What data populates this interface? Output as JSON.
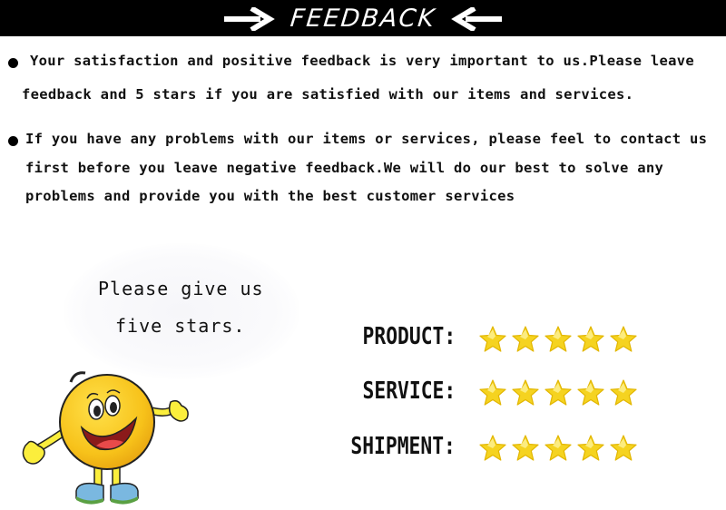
{
  "banner": {
    "title": "FEEDBACK",
    "left_icon": "arrow-right-icon",
    "right_icon": "arrow-left-icon",
    "background": "#000000",
    "text_color": "#ffffff"
  },
  "paragraphs": [
    {
      "bullet": "bullet-icon",
      "lines": [
        "Your satisfaction and positive feedback is very important to us.Please leave",
        "feedback and 5 stars if you are satisfied with our items and services."
      ]
    },
    {
      "bullet": "bullet-icon",
      "lines": [
        "If you have any problems with our items or services, please feel to contact us",
        "first before you leave negative feedback.We will do our best to solve any",
        "problems and provide you with the best customer services"
      ]
    }
  ],
  "speech_bubble": {
    "lines": [
      "Please give us",
      "five stars."
    ]
  },
  "mascot": {
    "icon": "smiley-mascot-icon",
    "face_color": "#f7c21a",
    "shoe_color": "#7ab8e0"
  },
  "ratings": [
    {
      "label": "PRODUCT:",
      "stars": 5,
      "max": 5
    },
    {
      "label": "SERVICE:",
      "stars": 5,
      "max": 5
    },
    {
      "label": "SHIPMENT:",
      "stars": 5,
      "max": 5
    }
  ],
  "colors": {
    "star": "#f5d320",
    "star_edge": "#e2b600"
  }
}
